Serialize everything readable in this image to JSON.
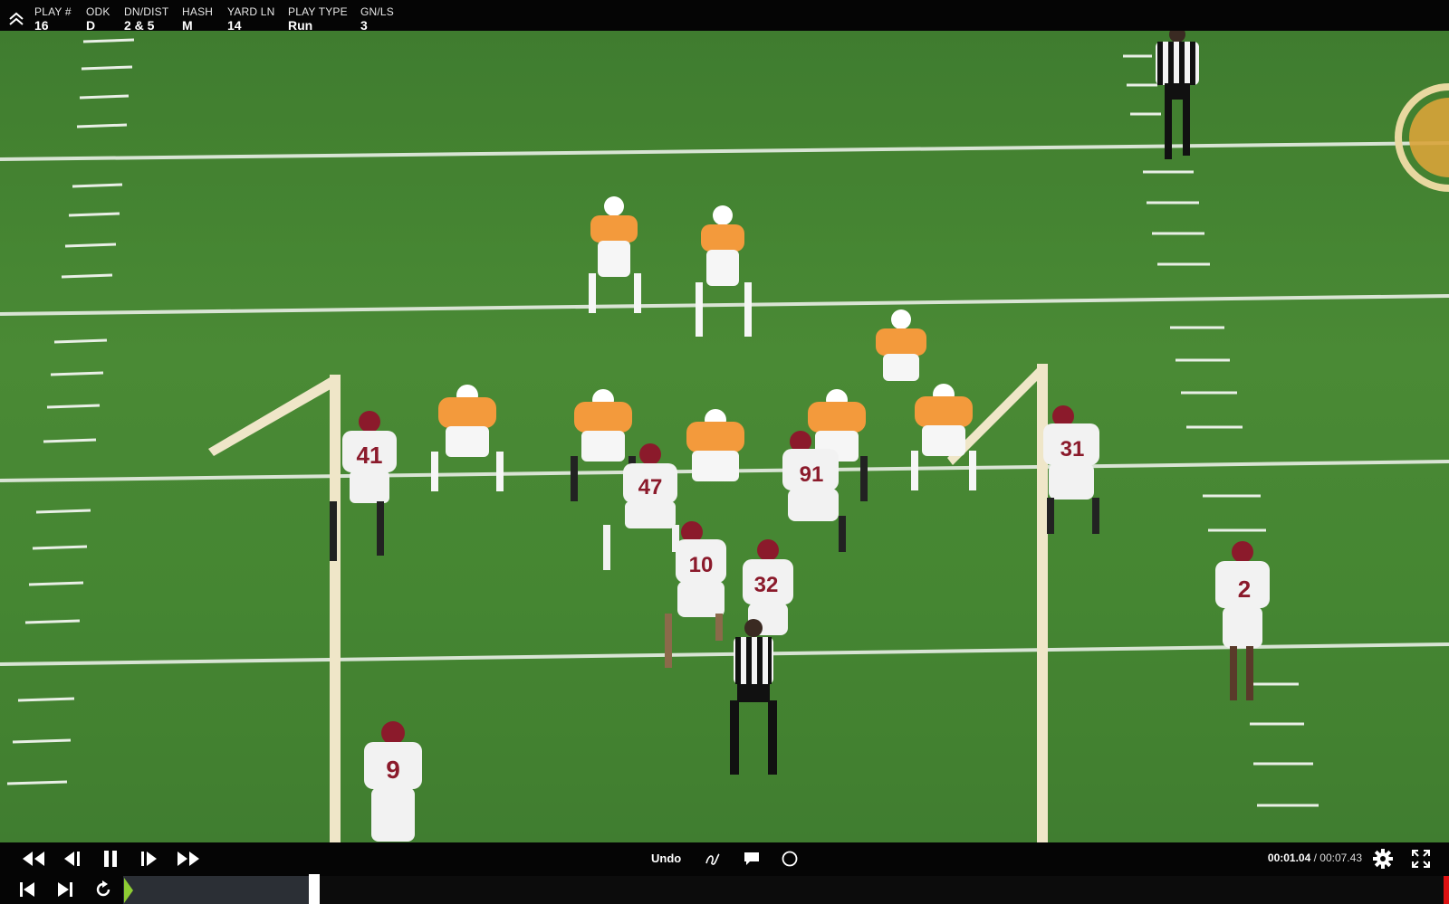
{
  "header": {
    "fields": [
      {
        "label": "PLAY #",
        "value": "16"
      },
      {
        "label": "ODK",
        "value": "D"
      },
      {
        "label": "DN/DIST",
        "value": "2 & 5"
      },
      {
        "label": "HASH",
        "value": "M"
      },
      {
        "label": "YARD LN",
        "value": "14"
      },
      {
        "label": "PLAY TYPE",
        "value": "Run"
      },
      {
        "label": "GN/LS",
        "value": "3"
      }
    ]
  },
  "video": {
    "jerseys": [
      "41",
      "47",
      "91",
      "10",
      "32",
      "31",
      "2",
      "9"
    ]
  },
  "controls": {
    "undo_label": "Undo",
    "current_time": "00:01.04",
    "separator": " / ",
    "total_time": "00:07.43",
    "progress_fraction": 0.14
  },
  "colors": {
    "accent_green": "#8dcc33",
    "end_marker": "#dd1111",
    "offense_jersey": "#f39a3c",
    "defense_jersey": "#f2f2f2",
    "defense_helmet": "#8b1a2b"
  }
}
